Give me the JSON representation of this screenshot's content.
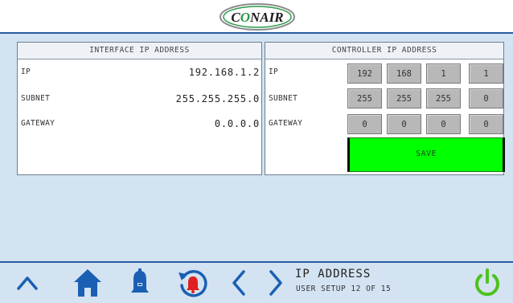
{
  "header": {
    "logo_text": "CONAIR"
  },
  "interface_panel": {
    "title": "INTERFACE IP ADDRESS",
    "rows": [
      {
        "label": "IP",
        "value": "192.168.1.2"
      },
      {
        "label": "SUBNET",
        "value": "255.255.255.0"
      },
      {
        "label": "GATEWAY",
        "value": "0.0.0.0"
      }
    ]
  },
  "controller_panel": {
    "title": "CONTROLLER IP ADDRESS",
    "rows": [
      {
        "label": "IP",
        "octets": [
          "192",
          "168",
          "1",
          "1"
        ]
      },
      {
        "label": "SUBNET",
        "octets": [
          "255",
          "255",
          "255",
          "0"
        ]
      },
      {
        "label": "GATEWAY",
        "octets": [
          "0",
          "0",
          "0",
          "0"
        ]
      }
    ],
    "save_label": "SAVE"
  },
  "footer": {
    "page_title": "IP ADDRESS",
    "page_subtitle": "USER SETUP 12 OF 15",
    "icons": [
      "chevron-up-icon",
      "home-icon",
      "alarm-bell-icon",
      "alarm-reset-icon",
      "chevron-left-icon",
      "chevron-right-icon",
      "power-icon"
    ]
  },
  "colors": {
    "background": "#d3e3f1",
    "accent": "#2a5aa0",
    "save_green": "#00ff00",
    "home_blue": "#1a5fb4",
    "alarm_red": "#e02020",
    "power_green": "#4cc21a"
  }
}
